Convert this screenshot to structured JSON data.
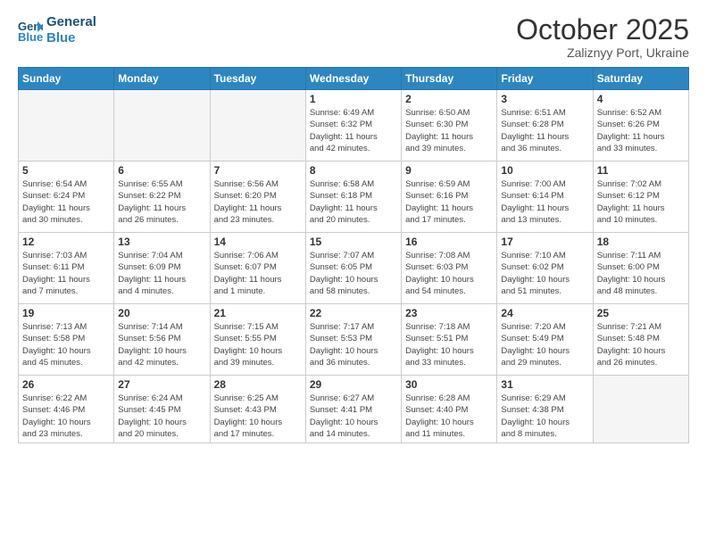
{
  "header": {
    "logo_line1": "General",
    "logo_line2": "Blue",
    "month": "October 2025",
    "location": "Zaliznyy Port, Ukraine"
  },
  "days_of_week": [
    "Sunday",
    "Monday",
    "Tuesday",
    "Wednesday",
    "Thursday",
    "Friday",
    "Saturday"
  ],
  "weeks": [
    [
      {
        "day": "",
        "info": ""
      },
      {
        "day": "",
        "info": ""
      },
      {
        "day": "",
        "info": ""
      },
      {
        "day": "1",
        "info": "Sunrise: 6:49 AM\nSunset: 6:32 PM\nDaylight: 11 hours\nand 42 minutes."
      },
      {
        "day": "2",
        "info": "Sunrise: 6:50 AM\nSunset: 6:30 PM\nDaylight: 11 hours\nand 39 minutes."
      },
      {
        "day": "3",
        "info": "Sunrise: 6:51 AM\nSunset: 6:28 PM\nDaylight: 11 hours\nand 36 minutes."
      },
      {
        "day": "4",
        "info": "Sunrise: 6:52 AM\nSunset: 6:26 PM\nDaylight: 11 hours\nand 33 minutes."
      }
    ],
    [
      {
        "day": "5",
        "info": "Sunrise: 6:54 AM\nSunset: 6:24 PM\nDaylight: 11 hours\nand 30 minutes."
      },
      {
        "day": "6",
        "info": "Sunrise: 6:55 AM\nSunset: 6:22 PM\nDaylight: 11 hours\nand 26 minutes."
      },
      {
        "day": "7",
        "info": "Sunrise: 6:56 AM\nSunset: 6:20 PM\nDaylight: 11 hours\nand 23 minutes."
      },
      {
        "day": "8",
        "info": "Sunrise: 6:58 AM\nSunset: 6:18 PM\nDaylight: 11 hours\nand 20 minutes."
      },
      {
        "day": "9",
        "info": "Sunrise: 6:59 AM\nSunset: 6:16 PM\nDaylight: 11 hours\nand 17 minutes."
      },
      {
        "day": "10",
        "info": "Sunrise: 7:00 AM\nSunset: 6:14 PM\nDaylight: 11 hours\nand 13 minutes."
      },
      {
        "day": "11",
        "info": "Sunrise: 7:02 AM\nSunset: 6:12 PM\nDaylight: 11 hours\nand 10 minutes."
      }
    ],
    [
      {
        "day": "12",
        "info": "Sunrise: 7:03 AM\nSunset: 6:11 PM\nDaylight: 11 hours\nand 7 minutes."
      },
      {
        "day": "13",
        "info": "Sunrise: 7:04 AM\nSunset: 6:09 PM\nDaylight: 11 hours\nand 4 minutes."
      },
      {
        "day": "14",
        "info": "Sunrise: 7:06 AM\nSunset: 6:07 PM\nDaylight: 11 hours\nand 1 minute."
      },
      {
        "day": "15",
        "info": "Sunrise: 7:07 AM\nSunset: 6:05 PM\nDaylight: 10 hours\nand 58 minutes."
      },
      {
        "day": "16",
        "info": "Sunrise: 7:08 AM\nSunset: 6:03 PM\nDaylight: 10 hours\nand 54 minutes."
      },
      {
        "day": "17",
        "info": "Sunrise: 7:10 AM\nSunset: 6:02 PM\nDaylight: 10 hours\nand 51 minutes."
      },
      {
        "day": "18",
        "info": "Sunrise: 7:11 AM\nSunset: 6:00 PM\nDaylight: 10 hours\nand 48 minutes."
      }
    ],
    [
      {
        "day": "19",
        "info": "Sunrise: 7:13 AM\nSunset: 5:58 PM\nDaylight: 10 hours\nand 45 minutes."
      },
      {
        "day": "20",
        "info": "Sunrise: 7:14 AM\nSunset: 5:56 PM\nDaylight: 10 hours\nand 42 minutes."
      },
      {
        "day": "21",
        "info": "Sunrise: 7:15 AM\nSunset: 5:55 PM\nDaylight: 10 hours\nand 39 minutes."
      },
      {
        "day": "22",
        "info": "Sunrise: 7:17 AM\nSunset: 5:53 PM\nDaylight: 10 hours\nand 36 minutes."
      },
      {
        "day": "23",
        "info": "Sunrise: 7:18 AM\nSunset: 5:51 PM\nDaylight: 10 hours\nand 33 minutes."
      },
      {
        "day": "24",
        "info": "Sunrise: 7:20 AM\nSunset: 5:49 PM\nDaylight: 10 hours\nand 29 minutes."
      },
      {
        "day": "25",
        "info": "Sunrise: 7:21 AM\nSunset: 5:48 PM\nDaylight: 10 hours\nand 26 minutes."
      }
    ],
    [
      {
        "day": "26",
        "info": "Sunrise: 6:22 AM\nSunset: 4:46 PM\nDaylight: 10 hours\nand 23 minutes."
      },
      {
        "day": "27",
        "info": "Sunrise: 6:24 AM\nSunset: 4:45 PM\nDaylight: 10 hours\nand 20 minutes."
      },
      {
        "day": "28",
        "info": "Sunrise: 6:25 AM\nSunset: 4:43 PM\nDaylight: 10 hours\nand 17 minutes."
      },
      {
        "day": "29",
        "info": "Sunrise: 6:27 AM\nSunset: 4:41 PM\nDaylight: 10 hours\nand 14 minutes."
      },
      {
        "day": "30",
        "info": "Sunrise: 6:28 AM\nSunset: 4:40 PM\nDaylight: 10 hours\nand 11 minutes."
      },
      {
        "day": "31",
        "info": "Sunrise: 6:29 AM\nSunset: 4:38 PM\nDaylight: 10 hours\nand 8 minutes."
      },
      {
        "day": "",
        "info": ""
      }
    ]
  ]
}
